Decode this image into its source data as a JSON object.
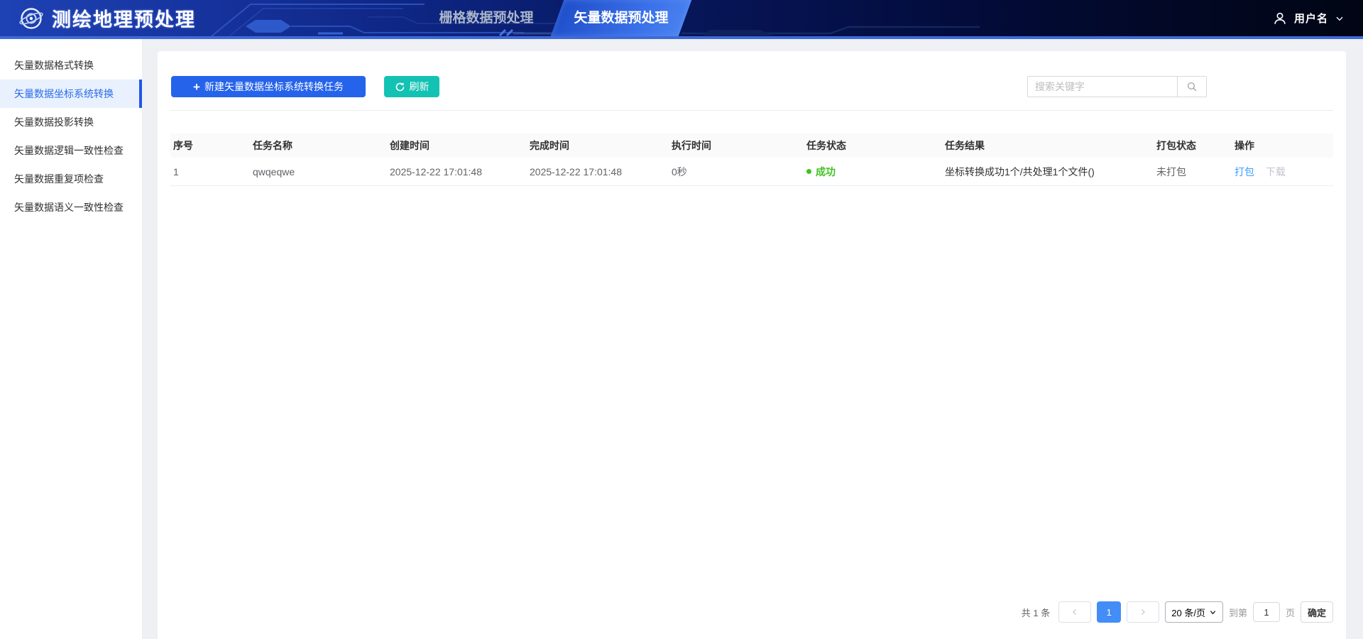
{
  "header": {
    "app_title": "测绘地理预处理",
    "tabs": [
      {
        "label": "栅格数据预处理"
      },
      {
        "label": "矢量数据预处理"
      }
    ],
    "username": "用户名"
  },
  "sidebar": {
    "items": [
      {
        "label": "矢量数据格式转换"
      },
      {
        "label": "矢量数据坐标系统转换"
      },
      {
        "label": "矢量数据投影转换"
      },
      {
        "label": "矢量数据逻辑一致性检查"
      },
      {
        "label": "矢量数据重复项检查"
      },
      {
        "label": "矢量数据语义一致性检查"
      }
    ]
  },
  "toolbar": {
    "new_task_label": "新建矢量数据坐标系统转换任务",
    "refresh_label": "刷新",
    "search_placeholder": "搜索关键字"
  },
  "table": {
    "columns": [
      "序号",
      "任务名称",
      "创建时间",
      "完成时间",
      "执行时间",
      "任务状态",
      "任务结果",
      "打包状态",
      "操作"
    ],
    "rows": [
      {
        "index": "1",
        "name": "qwqeqwe",
        "created_at": "2025-12-22 17:01:48",
        "finished_at": "2025-12-22 17:01:48",
        "duration": "0秒",
        "status": "成功",
        "result": "坐标转换成功1个/共处理1个文件()",
        "pack_status": "未打包",
        "action_pack": "打包",
        "action_download": "下载"
      }
    ]
  },
  "pagination": {
    "total": "共 1 条",
    "page": "1",
    "page_size": "20 条/页",
    "goto_prefix": "到第",
    "goto_value": "1",
    "goto_suffix": "页",
    "confirm_label": "确定"
  },
  "colors": {
    "accent_blue": "#2563eb",
    "refresh_teal": "#13c2b3",
    "success_green": "#3ec31f",
    "link_blue": "#409eff",
    "header_underline": "#3e6ad9",
    "active_menu_blue": "#2a6ce8"
  }
}
